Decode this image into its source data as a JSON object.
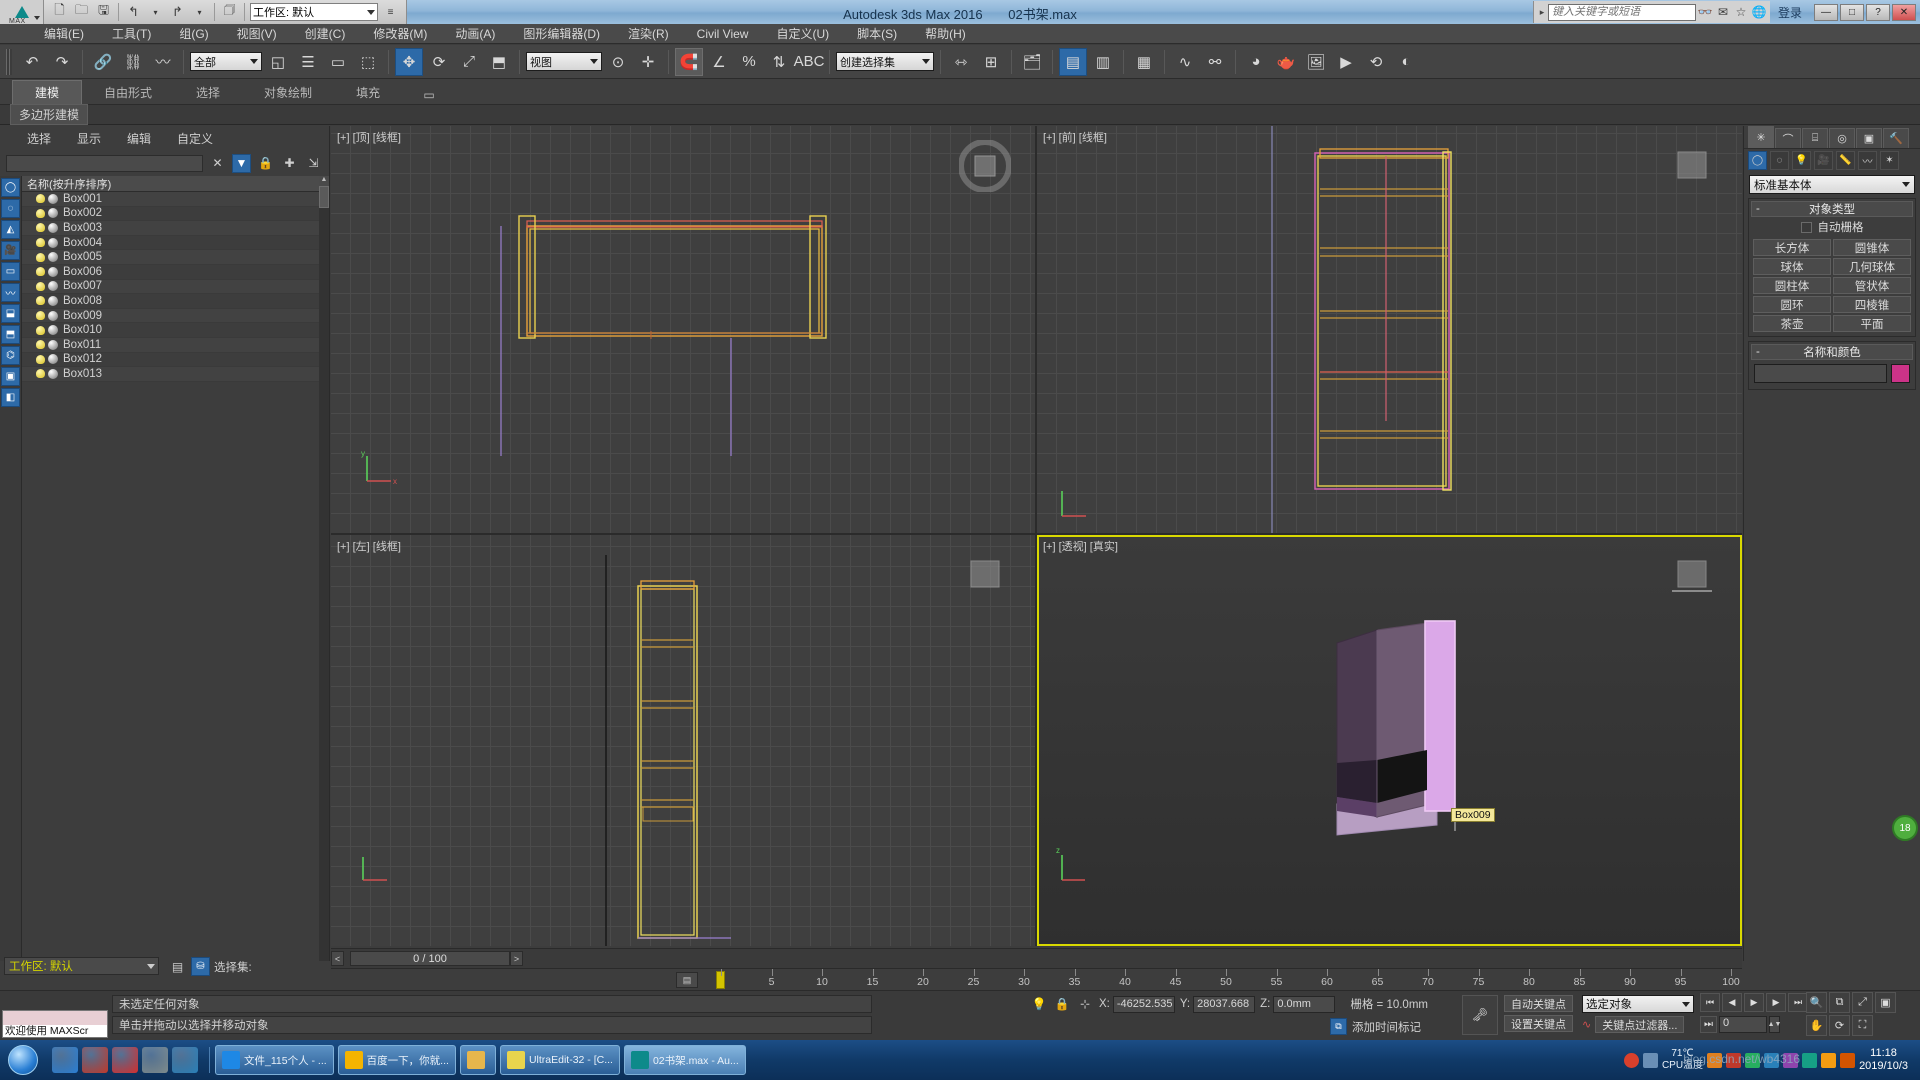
{
  "window": {
    "app_title": "Autodesk 3ds Max 2016",
    "file_name": "02书架.max",
    "sign_in": "登录",
    "minimize": "—",
    "maximize": "□",
    "close": "✕",
    "help": "?"
  },
  "quick_access": {
    "workspace_label": "工作区:",
    "workspace_value": "默认",
    "new_icon": "new-file-icon",
    "open_icon": "open-file-icon",
    "save_icon": "save-icon",
    "undo_icon": "undo-icon",
    "redo_icon": "redo-icon",
    "project_icon": "project-folder-icon"
  },
  "search": {
    "placeholder": "键入关键字或短语"
  },
  "menu": {
    "items": [
      "编辑(E)",
      "工具(T)",
      "组(G)",
      "视图(V)",
      "创建(C)",
      "修改器(M)",
      "动画(A)",
      "图形编辑器(D)",
      "渲染(R)",
      "Civil View",
      "自定义(U)",
      "脚本(S)",
      "帮助(H)"
    ]
  },
  "main_toolbar": {
    "selection_filter": "全部",
    "named_selection_sets": "创建选择集",
    "buttons": [
      "undo-icon",
      "redo-icon",
      "select-link-icon",
      "unlink-icon",
      "bind-space-warp-icon",
      "select-object-icon",
      "select-by-name-icon",
      "rect-select-region-icon",
      "window-crossing-icon",
      "select-and-move-icon",
      "select-and-rotate-icon",
      "select-and-scale-icon",
      "placement-icon",
      "ref-coord-system-icon",
      "use-pivot-icon",
      "mirror-icon",
      "align-icon",
      "toggle-scene-explorer-icon",
      "layer-explorer-icon",
      "ribbon-toggle-icon",
      "curve-editor-icon",
      "schematic-view-icon",
      "material-editor-icon",
      "render-setup-icon",
      "render-frame-icon",
      "render-production-icon",
      "render-iterative-icon",
      "activeshade-icon"
    ]
  },
  "ribbon": {
    "tabs": [
      "建模",
      "自由形式",
      "选择",
      "对象绘制",
      "填充"
    ],
    "active_tab": "建模",
    "subtab": "多边形建模"
  },
  "scene_explorer": {
    "menu": [
      "选择",
      "显示",
      "编辑",
      "自定义"
    ],
    "search_value": "",
    "column_header": "名称(按升序排序)",
    "toolbar_icons": [
      "clear-search-icon",
      "filter-icon",
      "lock-icon",
      "add-icon",
      "select-children-icon"
    ],
    "side_icons": [
      "geometry-filter-icon",
      "shapes-filter-icon",
      "lights-filter-icon",
      "cameras-filter-icon",
      "helpers-filter-icon",
      "space-warps-filter-icon",
      "groups-filter-icon",
      "xrefs-filter-icon",
      "bones-filter-icon",
      "freeze-filter-icon",
      "hide-filter-icon"
    ],
    "objects": [
      "Box001",
      "Box002",
      "Box003",
      "Box004",
      "Box005",
      "Box006",
      "Box007",
      "Box008",
      "Box009",
      "Box010",
      "Box011",
      "Box012",
      "Box013"
    ]
  },
  "viewports": [
    {
      "label": "[+] [顶] [线框]",
      "id": "top",
      "active": false
    },
    {
      "label": "[+] [前] [线框]",
      "id": "front",
      "active": false
    },
    {
      "label": "[+] [左] [线框]",
      "id": "left",
      "active": false
    },
    {
      "label": "[+] [透视] [真实]",
      "id": "perspective",
      "active": true
    }
  ],
  "viewport_tooltip": "Box009",
  "command_panel": {
    "tabs": [
      "create-tab-icon",
      "modify-tab-icon",
      "hierarchy-tab-icon",
      "motion-tab-icon",
      "display-tab-icon",
      "utilities-tab-icon"
    ],
    "active_tab_index": 0,
    "category_icons": [
      "geometry-icon",
      "shapes-icon",
      "lights-icon",
      "cameras-icon",
      "helpers-icon",
      "space-warps-icon",
      "systems-icon"
    ],
    "subcategory": "标准基本体",
    "object_type_rollout": "对象类型",
    "autogrid_label": "自动栅格",
    "object_buttons": [
      "长方体",
      "圆锥体",
      "球体",
      "几何球体",
      "圆柱体",
      "管状体",
      "圆环",
      "四棱锥",
      "茶壶",
      "平面"
    ],
    "name_color_rollout": "名称和颜色",
    "name_value": "",
    "color_swatch": "#cc3388",
    "collapse_glyph": "-"
  },
  "track_bar": {
    "frame_readout": "0 / 100",
    "prev_arrow": "<",
    "next_arrow": ">",
    "ticks": [
      0,
      5,
      10,
      15,
      20,
      25,
      30,
      35,
      40,
      45,
      50,
      55,
      60,
      65,
      70,
      75,
      80,
      85,
      90,
      95,
      100
    ]
  },
  "status_bar": {
    "workspace_label": "工作区: 默认",
    "selection_set_label": "选择集:",
    "maxscript_mini_listener": "欢迎使用 MAXScr",
    "status_text_1": "未选定任何对象",
    "status_text_2": "单击并拖动以选择并移动对象",
    "coords": {
      "x_label": "X:",
      "x_value": "-46252.535",
      "y_label": "Y:",
      "y_value": "28037.668",
      "z_label": "Z:",
      "z_value": "0.0mm"
    },
    "grid_label": "栅格 = 10.0mm",
    "time_tag": "添加时间标记",
    "auto_key": "自动关键点",
    "set_key": "设置关键点",
    "key_mode_value": "选定对象",
    "key_filters": "关键点过滤器...",
    "key_counter": "0",
    "lock_icon": "selection-lock-icon",
    "absolute_mode_icon": "absolute-relative-toggle-icon",
    "adaptive_degradation_icon": "adaptive-degradation-icon"
  },
  "nav_buttons": [
    "zoom-icon",
    "zoom-all-icon",
    "zoom-extents-icon",
    "zoom-region-icon",
    "pan-icon",
    "orbit-icon",
    "maximize-viewport-icon"
  ],
  "playback_buttons": [
    "go-to-start-icon",
    "previous-frame-icon",
    "play-icon",
    "next-frame-icon",
    "go-to-end-icon"
  ],
  "taskbar": {
    "start_label": "start-orb-icon",
    "quick_launch": [
      "ie-icon",
      "security-icon",
      "opera-icon",
      "notepad-icon",
      "calc-icon"
    ],
    "tasks": [
      {
        "icon": "115-drive-icon",
        "label": "文件_115个人 - ...",
        "active": false
      },
      {
        "icon": "chrome-icon",
        "label": "百度一下，你就...",
        "active": false
      },
      {
        "icon": "folder-icon",
        "label": "",
        "active": false
      },
      {
        "icon": "ultraedit-icon",
        "label": "UltraEdit-32 - [C...",
        "active": false
      },
      {
        "icon": "3dsmax-icon",
        "label": "02书架.max - Au...",
        "active": true
      }
    ],
    "tray": {
      "cpu_temp": "71℃",
      "cpu_temp_label": "CPU温度",
      "time": "11:18",
      "date": "2019/10/3"
    },
    "watermark": "blog.csdn.net/wb4316"
  },
  "badge": {
    "value": "18"
  }
}
